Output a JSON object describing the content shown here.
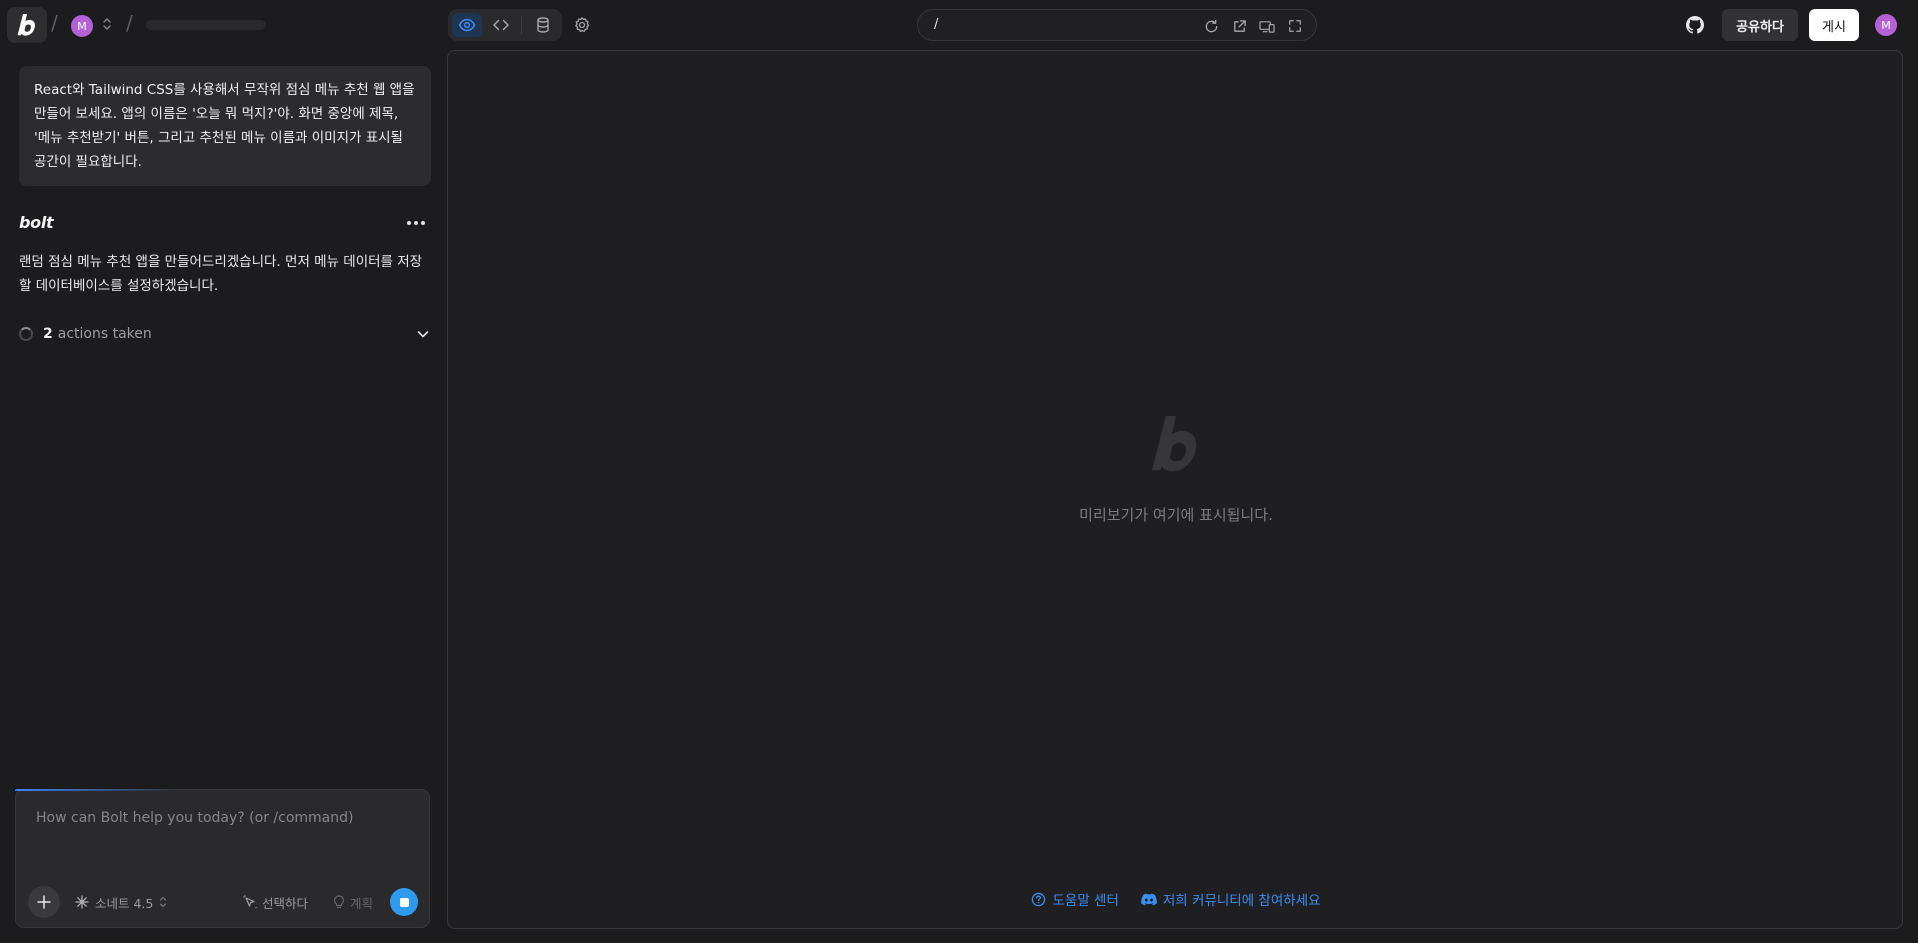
{
  "header": {
    "separator": "/",
    "org_avatar": "M",
    "view_tabs": [
      {
        "name": "preview",
        "icon": "eye-icon",
        "active": true
      },
      {
        "name": "code",
        "icon": "code-icon",
        "active": false
      },
      {
        "name": "database",
        "icon": "database-icon",
        "active": false
      }
    ],
    "url_path": "/",
    "share_label": "공유하다",
    "publish_label": "게시",
    "user_avatar": "M"
  },
  "chat": {
    "user_message": "React와 Tailwind CSS를 사용해서 무작위 점심 메뉴 추천 웹 앱을 만들어 보세요. 앱의 이름은 '오늘 뭐 먹지?'야. 화면 중앙에 제목, '메뉴 추천받기' 버튼, 그리고 추천된 메뉴 이름과 이미지가 표시될 공간이 필요합니다.",
    "assistant_name": "bolt",
    "assistant_message": "랜덤 점심 메뉴 추천 앱을 만들어드리겠습니다. 먼저 메뉴 데이터를 저장할 데이터베이스를 설정하겠습니다.",
    "actions_count": "2",
    "actions_label": "actions taken"
  },
  "composer": {
    "placeholder": "How can Bolt help you today? (or /command)",
    "model_label": "소네트 4.5",
    "select_label": "선택하다",
    "plan_label": "계획"
  },
  "preview": {
    "empty_text": "미리보기가 여기에 표시됩니다.",
    "help_link": "도움말 센터",
    "community_link": "저희 커뮤니티에 참여하세요"
  },
  "colors": {
    "accent": "#3b8df3",
    "stop_button": "#2f9bf0",
    "avatar": "#b561d6",
    "background": "#1c1c1e"
  }
}
